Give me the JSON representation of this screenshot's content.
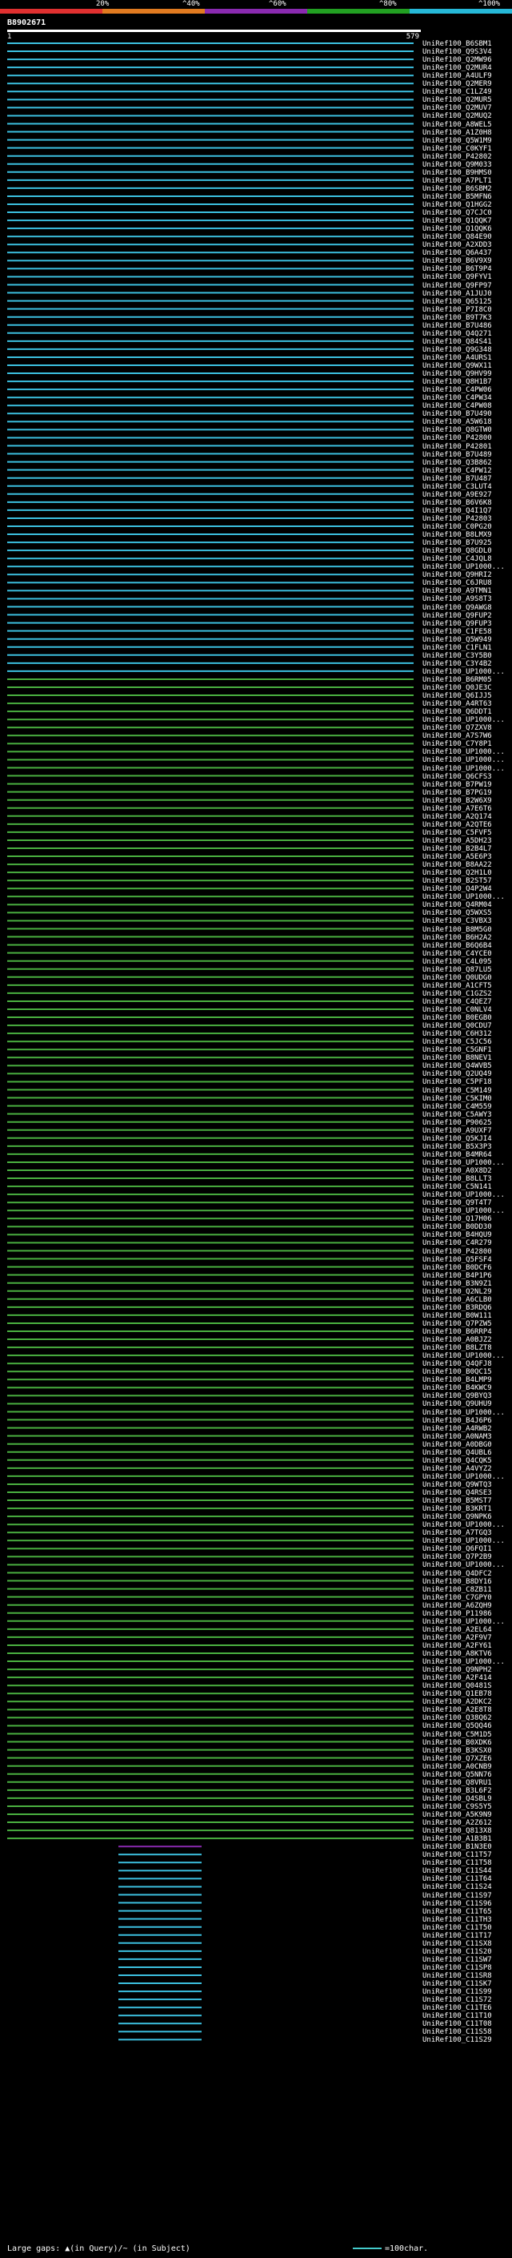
{
  "scale": {
    "labels": [
      "20%",
      "^40%",
      "^60%",
      "^80%",
      "^100%"
    ],
    "colors": [
      "#e03030",
      "#e07a20",
      "#8a2ab0",
      "#22a022",
      "#26b8d8"
    ]
  },
  "query_id": "B8902671",
  "ruler": {
    "start": "1",
    "end": "579"
  },
  "hits": [
    {
      "label": "UniRef100_B6SBM1",
      "color": "#3cc0e0"
    },
    {
      "label": "UniRef100_Q9S3V4",
      "color": "#3cc0e0"
    },
    {
      "label": "UniRef100_Q2MW96",
      "color": "#3cc0e0"
    },
    {
      "label": "UniRef100_Q2MUR4",
      "color": "#3cc0e0"
    },
    {
      "label": "UniRef100_A4ULF9",
      "color": "#3cc0e0"
    },
    {
      "label": "UniRef100_Q2MER9",
      "color": "#3cc0e0"
    },
    {
      "label": "UniRef100_C1LZ49",
      "color": "#3cc0e0"
    },
    {
      "label": "UniRef100_Q2MUR5",
      "color": "#3cc0e0"
    },
    {
      "label": "UniRef100_Q2MUV7",
      "color": "#3cc0e0"
    },
    {
      "label": "UniRef100_Q2MUQ2",
      "color": "#3cc0e0"
    },
    {
      "label": "UniRef100_A8WEL5",
      "color": "#3cc0e0"
    },
    {
      "label": "UniRef100_A1Z0H8",
      "color": "#3cc0e0"
    },
    {
      "label": "UniRef100_Q5W1M9",
      "color": "#3cc0e0"
    },
    {
      "label": "UniRef100_C0KYF1",
      "color": "#3cc0e0"
    },
    {
      "label": "UniRef100_P42802",
      "color": "#3cc0e0"
    },
    {
      "label": "UniRef100_Q9M033",
      "color": "#3cc0e0"
    },
    {
      "label": "UniRef100_B9HMS0",
      "color": "#3cc0e0"
    },
    {
      "label": "UniRef100_A7PLT1",
      "color": "#3cc0e0"
    },
    {
      "label": "UniRef100_B6SBM2",
      "color": "#3cc0e0"
    },
    {
      "label": "UniRef100_B5MFN6",
      "color": "#3cc0e0"
    },
    {
      "label": "UniRef100_Q1HGG2",
      "color": "#3cc0e0"
    },
    {
      "label": "UniRef100_Q7CJC0",
      "color": "#3cc0e0"
    },
    {
      "label": "UniRef100_Q1QQK7",
      "color": "#3cc0e0"
    },
    {
      "label": "UniRef100_Q1QQK6",
      "color": "#3cc0e0"
    },
    {
      "label": "UniRef100_Q84E90",
      "color": "#3cc0e0"
    },
    {
      "label": "UniRef100_A2XDD3",
      "color": "#3cc0e0"
    },
    {
      "label": "UniRef100_Q6A437",
      "color": "#3cc0e0"
    },
    {
      "label": "UniRef100_B6V9X9",
      "color": "#3cc0e0"
    },
    {
      "label": "UniRef100_B6T9P4",
      "color": "#3cc0e0"
    },
    {
      "label": "UniRef100_Q9FYV1",
      "color": "#3cc0e0"
    },
    {
      "label": "UniRef100_Q9FP97",
      "color": "#3cc0e0"
    },
    {
      "label": "UniRef100_A1JUJ0",
      "color": "#3cc0e0"
    },
    {
      "label": "UniRef100_Q65125",
      "color": "#3cc0e0"
    },
    {
      "label": "UniRef100_P7I8C0",
      "color": "#3cc0e0"
    },
    {
      "label": "UniRef100_B9T7K3",
      "color": "#3cc0e0"
    },
    {
      "label": "UniRef100_B7U486",
      "color": "#3cc0e0"
    },
    {
      "label": "UniRef100_Q4Q271",
      "color": "#3cc0e0"
    },
    {
      "label": "UniRef100_Q84S41",
      "color": "#3cc0e0"
    },
    {
      "label": "UniRef100_Q9G348",
      "color": "#3cc0e0"
    },
    {
      "label": "UniRef100_A4URS1",
      "color": "#3cc0e0"
    },
    {
      "label": "UniRef100_Q9WX11",
      "color": "#3cc0e0"
    },
    {
      "label": "UniRef100_Q9HV99",
      "color": "#3cc0e0"
    },
    {
      "label": "UniRef100_Q8H1B7",
      "color": "#3cc0e0"
    },
    {
      "label": "UniRef100_C4PW06",
      "color": "#3cc0e0"
    },
    {
      "label": "UniRef100_C4PW34",
      "color": "#3cc0e0"
    },
    {
      "label": "UniRef100_C4PW08",
      "color": "#3cc0e0"
    },
    {
      "label": "UniRef100_B7U490",
      "color": "#3cc0e0"
    },
    {
      "label": "UniRef100_A5W618",
      "color": "#3cc0e0"
    },
    {
      "label": "UniRef100_Q8GTW0",
      "color": "#3cc0e0"
    },
    {
      "label": "UniRef100_P42800",
      "color": "#3cc0e0"
    },
    {
      "label": "UniRef100_P42801",
      "color": "#3cc0e0"
    },
    {
      "label": "UniRef100_B7U489",
      "color": "#3cc0e0"
    },
    {
      "label": "UniRef100_Q3B862",
      "color": "#3cc0e0"
    },
    {
      "label": "UniRef100_C4PW12",
      "color": "#3cc0e0"
    },
    {
      "label": "UniRef100_B7U487",
      "color": "#3cc0e0"
    },
    {
      "label": "UniRef100_C3LUT4",
      "color": "#3cc0e0"
    },
    {
      "label": "UniRef100_A9E927",
      "color": "#3cc0e0"
    },
    {
      "label": "UniRef100_B6V6K8",
      "color": "#3cc0e0"
    },
    {
      "label": "UniRef100_Q4I1Q7",
      "color": "#3cc0e0"
    },
    {
      "label": "UniRef100_P42803",
      "color": "#3cc0e0"
    },
    {
      "label": "UniRef100_C0PG20",
      "color": "#3cc0e0"
    },
    {
      "label": "UniRef100_B8LMX9",
      "color": "#3cc0e0"
    },
    {
      "label": "UniRef100_B7U925",
      "color": "#3cc0e0"
    },
    {
      "label": "UniRef100_Q8GDL0",
      "color": "#3cc0e0"
    },
    {
      "label": "UniRef100_C4JQL8",
      "color": "#3cc0e0"
    },
    {
      "label": "UniRef100_UP1000...",
      "color": "#3cc0e0"
    },
    {
      "label": "UniRef100_Q9HRI2",
      "color": "#3cc0e0"
    },
    {
      "label": "UniRef100_C6JRU8",
      "color": "#3cc0e0"
    },
    {
      "label": "UniRef100_A9TMN1",
      "color": "#3cc0e0"
    },
    {
      "label": "UniRef100_A9S8T3",
      "color": "#3cc0e0"
    },
    {
      "label": "UniRef100_Q9AWG8",
      "color": "#3cc0e0"
    },
    {
      "label": "UniRef100_Q9FUP2",
      "color": "#3cc0e0"
    },
    {
      "label": "UniRef100_Q9FUP3",
      "color": "#3cc0e0"
    },
    {
      "label": "UniRef100_C1FE58",
      "color": "#3cc0e0"
    },
    {
      "label": "UniRef100_Q5W949",
      "color": "#3cc0e0"
    },
    {
      "label": "UniRef100_C1FLN1",
      "color": "#3cc0e0"
    },
    {
      "label": "UniRef100_C3Y5B0",
      "color": "#3cc0e0"
    },
    {
      "label": "UniRef100_C3Y4B2",
      "color": "#3cc0e0"
    },
    {
      "label": "UniRef100_UP1000...",
      "color": "#3cc0e0"
    },
    {
      "label": "UniRef100_B6RM05",
      "color": "#4ab040"
    },
    {
      "label": "UniRef100_Q0JE3C",
      "color": "#4ab040"
    },
    {
      "label": "UniRef100_Q6IJJ5",
      "color": "#4ab040"
    },
    {
      "label": "UniRef100_A4RT63",
      "color": "#4ab040"
    },
    {
      "label": "UniRef100_Q6DDT1",
      "color": "#4ab040"
    },
    {
      "label": "UniRef100_UP1000...",
      "color": "#4ab040"
    },
    {
      "label": "UniRef100_Q7ZXV8",
      "color": "#4ab040"
    },
    {
      "label": "UniRef100_A7S7W6",
      "color": "#4ab040"
    },
    {
      "label": "UniRef100_C7Y8P1",
      "color": "#4ab040"
    },
    {
      "label": "UniRef100_UP1000...",
      "color": "#4ab040"
    },
    {
      "label": "UniRef100_UP1000...",
      "color": "#4ab040"
    },
    {
      "label": "UniRef100_UP1000...",
      "color": "#4ab040"
    },
    {
      "label": "UniRef100_Q6CFS3",
      "color": "#4ab040"
    },
    {
      "label": "UniRef100_B7PW19",
      "color": "#4ab040"
    },
    {
      "label": "UniRef100_B7PG19",
      "color": "#4ab040"
    },
    {
      "label": "UniRef100_B2W6X9",
      "color": "#4ab040"
    },
    {
      "label": "UniRef100_A7E6T6",
      "color": "#4ab040"
    },
    {
      "label": "UniRef100_A2Q174",
      "color": "#4ab040"
    },
    {
      "label": "UniRef100_A2QTE6",
      "color": "#4ab040"
    },
    {
      "label": "UniRef100_C5FVF5",
      "color": "#4ab040"
    },
    {
      "label": "UniRef100_A5DH23",
      "color": "#4ab040"
    },
    {
      "label": "UniRef100_B2B4L7",
      "color": "#4ab040"
    },
    {
      "label": "UniRef100_A5E6P3",
      "color": "#4ab040"
    },
    {
      "label": "UniRef100_B8AA22",
      "color": "#4ab040"
    },
    {
      "label": "UniRef100_Q2H1L0",
      "color": "#4ab040"
    },
    {
      "label": "UniRef100_B2ST57",
      "color": "#4ab040"
    },
    {
      "label": "UniRef100_Q4P2W4",
      "color": "#4ab040"
    },
    {
      "label": "UniRef100_UP1000...",
      "color": "#4ab040"
    },
    {
      "label": "UniRef100_Q4RM04",
      "color": "#4ab040"
    },
    {
      "label": "UniRef100_Q5WXS5",
      "color": "#4ab040"
    },
    {
      "label": "UniRef100_C3VBX3",
      "color": "#4ab040"
    },
    {
      "label": "UniRef100_B8M5G0",
      "color": "#4ab040"
    },
    {
      "label": "UniRef100_B6H2A2",
      "color": "#4ab040"
    },
    {
      "label": "UniRef100_B6Q6B4",
      "color": "#4ab040"
    },
    {
      "label": "UniRef100_C4YCE0",
      "color": "#4ab040"
    },
    {
      "label": "UniRef100_C4L095",
      "color": "#4ab040"
    },
    {
      "label": "UniRef100_Q87LU5",
      "color": "#4ab040"
    },
    {
      "label": "UniRef100_Q0UDG0",
      "color": "#4ab040"
    },
    {
      "label": "UniRef100_A1CFT5",
      "color": "#4ab040"
    },
    {
      "label": "UniRef100_C1GZS2",
      "color": "#4ab040"
    },
    {
      "label": "UniRef100_C4QEZ7",
      "color": "#4ab040"
    },
    {
      "label": "UniRef100_C0NLV4",
      "color": "#4ab040"
    },
    {
      "label": "UniRef100_B0EGB0",
      "color": "#4ab040"
    },
    {
      "label": "UniRef100_Q0CDU7",
      "color": "#4ab040"
    },
    {
      "label": "UniRef100_C6H312",
      "color": "#4ab040"
    },
    {
      "label": "UniRef100_C5JC56",
      "color": "#4ab040"
    },
    {
      "label": "UniRef100_C5GNF1",
      "color": "#4ab040"
    },
    {
      "label": "UniRef100_B8NEV1",
      "color": "#4ab040"
    },
    {
      "label": "UniRef100_Q4WVB5",
      "color": "#4ab040"
    },
    {
      "label": "UniRef100_Q2UQ49",
      "color": "#4ab040"
    },
    {
      "label": "UniRef100_C5PF18",
      "color": "#4ab040"
    },
    {
      "label": "UniRef100_C5M149",
      "color": "#4ab040"
    },
    {
      "label": "UniRef100_C5KIM0",
      "color": "#4ab040"
    },
    {
      "label": "UniRef100_C4M559",
      "color": "#4ab040"
    },
    {
      "label": "UniRef100_C5AWY3",
      "color": "#4ab040"
    },
    {
      "label": "UniRef100_P90625",
      "color": "#4ab040"
    },
    {
      "label": "UniRef100_A9UXF7",
      "color": "#4ab040"
    },
    {
      "label": "UniRef100_Q5KJI4",
      "color": "#4ab040"
    },
    {
      "label": "UniRef100_B5X3P3",
      "color": "#4ab040"
    },
    {
      "label": "UniRef100_B4MR64",
      "color": "#4ab040"
    },
    {
      "label": "UniRef100_UP1000...",
      "color": "#4ab040"
    },
    {
      "label": "UniRef100_A0X8D2",
      "color": "#4ab040"
    },
    {
      "label": "UniRef100_B8LLT3",
      "color": "#4ab040"
    },
    {
      "label": "UniRef100_C5N141",
      "color": "#4ab040"
    },
    {
      "label": "UniRef100_UP1000...",
      "color": "#4ab040"
    },
    {
      "label": "UniRef100_Q9T4T7",
      "color": "#4ab040"
    },
    {
      "label": "UniRef100_UP1000...",
      "color": "#4ab040"
    },
    {
      "label": "UniRef100_Q17H06",
      "color": "#4ab040"
    },
    {
      "label": "UniRef100_B0DD30",
      "color": "#4ab040"
    },
    {
      "label": "UniRef100_B4HQU9",
      "color": "#4ab040"
    },
    {
      "label": "UniRef100_C4R279",
      "color": "#4ab040"
    },
    {
      "label": "UniRef100_P42800",
      "color": "#4ab040"
    },
    {
      "label": "UniRef100_Q5FSF4",
      "color": "#4ab040"
    },
    {
      "label": "UniRef100_B0DCF6",
      "color": "#4ab040"
    },
    {
      "label": "UniRef100_B4P1P6",
      "color": "#4ab040"
    },
    {
      "label": "UniRef100_B3N9Z1",
      "color": "#4ab040"
    },
    {
      "label": "UniRef100_Q2NL29",
      "color": "#4ab040"
    },
    {
      "label": "UniRef100_A6CLB0",
      "color": "#4ab040"
    },
    {
      "label": "UniRef100_B3RDQ6",
      "color": "#4ab040"
    },
    {
      "label": "UniRef100_B0W111",
      "color": "#4ab040"
    },
    {
      "label": "UniRef100_Q7PZW5",
      "color": "#4ab040"
    },
    {
      "label": "UniRef100_B6RRP4",
      "color": "#4ab040"
    },
    {
      "label": "UniRef100_A0BJZ2",
      "color": "#4ab040"
    },
    {
      "label": "UniRef100_B8LZT8",
      "color": "#4ab040"
    },
    {
      "label": "UniRef100_UP1000...",
      "color": "#4ab040"
    },
    {
      "label": "UniRef100_Q4QFJ8",
      "color": "#4ab040"
    },
    {
      "label": "UniRef100_B0QC15",
      "color": "#4ab040"
    },
    {
      "label": "UniRef100_B4LMP9",
      "color": "#4ab040"
    },
    {
      "label": "UniRef100_B4KWC9",
      "color": "#4ab040"
    },
    {
      "label": "UniRef100_Q9BYQ3",
      "color": "#4ab040"
    },
    {
      "label": "UniRef100_Q9UHU9",
      "color": "#4ab040"
    },
    {
      "label": "UniRef100_UP1000...",
      "color": "#4ab040"
    },
    {
      "label": "UniRef100_B4J6P6",
      "color": "#4ab040"
    },
    {
      "label": "UniRef100_A4RWB2",
      "color": "#4ab040"
    },
    {
      "label": "UniRef100_A0NAM3",
      "color": "#4ab040"
    },
    {
      "label": "UniRef100_A0DBG0",
      "color": "#4ab040"
    },
    {
      "label": "UniRef100_Q4UBL6",
      "color": "#4ab040"
    },
    {
      "label": "UniRef100_Q4CQK5",
      "color": "#4ab040"
    },
    {
      "label": "UniRef100_A4VYZ2",
      "color": "#4ab040"
    },
    {
      "label": "UniRef100_UP1000...",
      "color": "#4ab040"
    },
    {
      "label": "UniRef100_Q9WTQ3",
      "color": "#4ab040"
    },
    {
      "label": "UniRef100_Q4RSE3",
      "color": "#4ab040"
    },
    {
      "label": "UniRef100_B5MST7",
      "color": "#4ab040"
    },
    {
      "label": "UniRef100_B3KRT1",
      "color": "#4ab040"
    },
    {
      "label": "UniRef100_Q9NPK6",
      "color": "#4ab040"
    },
    {
      "label": "UniRef100_UP1000...",
      "color": "#4ab040"
    },
    {
      "label": "UniRef100_A7TGQ3",
      "color": "#4ab040"
    },
    {
      "label": "UniRef100_UP1000...",
      "color": "#4ab040"
    },
    {
      "label": "UniRef100_Q6FQI1",
      "color": "#4ab040"
    },
    {
      "label": "UniRef100_Q7P2B9",
      "color": "#4ab040"
    },
    {
      "label": "UniRef100_UP1000...",
      "color": "#4ab040"
    },
    {
      "label": "UniRef100_Q4DFC2",
      "color": "#4ab040"
    },
    {
      "label": "UniRef100_B8DY16",
      "color": "#4ab040"
    },
    {
      "label": "UniRef100_C8ZB11",
      "color": "#4ab040"
    },
    {
      "label": "UniRef100_C7GPY0",
      "color": "#4ab040"
    },
    {
      "label": "UniRef100_A6ZQH9",
      "color": "#4ab040"
    },
    {
      "label": "UniRef100_P11986",
      "color": "#4ab040"
    },
    {
      "label": "UniRef100_UP1000...",
      "color": "#4ab040"
    },
    {
      "label": "UniRef100_A2EL64",
      "color": "#4ab040"
    },
    {
      "label": "UniRef100_A2F9V7",
      "color": "#4ab040"
    },
    {
      "label": "UniRef100_A2FY61",
      "color": "#4ab040"
    },
    {
      "label": "UniRef100_A8KTV6",
      "color": "#4ab040"
    },
    {
      "label": "UniRef100_UP1000...",
      "color": "#4ab040"
    },
    {
      "label": "UniRef100_Q9NPH2",
      "color": "#4ab040"
    },
    {
      "label": "UniRef100_A2F414",
      "color": "#4ab040"
    },
    {
      "label": "UniRef100_Q0481S",
      "color": "#4ab040"
    },
    {
      "label": "UniRef100_Q1EB78",
      "color": "#4ab040"
    },
    {
      "label": "UniRef100_A2DKC2",
      "color": "#4ab040"
    },
    {
      "label": "UniRef100_A2E8T8",
      "color": "#4ab040"
    },
    {
      "label": "UniRef100_Q38Q62",
      "color": "#4ab040"
    },
    {
      "label": "UniRef100_Q5QQ46",
      "color": "#4ab040"
    },
    {
      "label": "UniRef100_C5M1D5",
      "color": "#4ab040"
    },
    {
      "label": "UniRef100_B0XDK6",
      "color": "#4ab040"
    },
    {
      "label": "UniRef100_B3KSX0",
      "color": "#4ab040"
    },
    {
      "label": "UniRef100_Q7XZE6",
      "color": "#4ab040"
    },
    {
      "label": "UniRef100_A0CNB9",
      "color": "#4ab040"
    },
    {
      "label": "UniRef100_Q5NN76",
      "color": "#4ab040"
    },
    {
      "label": "UniRef100_Q8VRU1",
      "color": "#4ab040"
    },
    {
      "label": "UniRef100_B3L6F2",
      "color": "#4ab040"
    },
    {
      "label": "UniRef100_Q4SBL9",
      "color": "#4ab040"
    },
    {
      "label": "UniRef100_C9S5Y5",
      "color": "#4ab040"
    },
    {
      "label": "UniRef100_A5K9N9",
      "color": "#4ab040"
    },
    {
      "label": "UniRef100_A2Z612",
      "color": "#4ab040"
    },
    {
      "label": "UniRef100_Q813X8",
      "color": "#4ab040"
    },
    {
      "label": "UniRef100_A1B3B1",
      "color": "#4ab040"
    },
    {
      "label": "UniRef100_B1N3E0",
      "color": "#8a2ab0"
    },
    {
      "label": "UniRef100_C11T57",
      "color": "#3cc0e0"
    },
    {
      "label": "UniRef100_C11T58",
      "color": "#3cc0e0"
    },
    {
      "label": "UniRef100_C11S44",
      "color": "#3cc0e0"
    },
    {
      "label": "UniRef100_C11T64",
      "color": "#3cc0e0"
    },
    {
      "label": "UniRef100_C11S24",
      "color": "#3cc0e0"
    },
    {
      "label": "UniRef100_C11S97",
      "color": "#3cc0e0"
    },
    {
      "label": "UniRef100_C11S96",
      "color": "#3cc0e0"
    },
    {
      "label": "UniRef100_C11T65",
      "color": "#3cc0e0"
    },
    {
      "label": "UniRef100_C11TH3",
      "color": "#3cc0e0"
    },
    {
      "label": "UniRef100_C11T50",
      "color": "#3cc0e0"
    },
    {
      "label": "UniRef100_C11T17",
      "color": "#3cc0e0"
    },
    {
      "label": "UniRef100_C11SX8",
      "color": "#3cc0e0"
    },
    {
      "label": "UniRef100_C11S20",
      "color": "#3cc0e0"
    },
    {
      "label": "UniRef100_C11SW7",
      "color": "#3cc0e0"
    },
    {
      "label": "UniRef100_C11SP8",
      "color": "#3cc0e0"
    },
    {
      "label": "UniRef100_C11SR8",
      "color": "#3cc0e0"
    },
    {
      "label": "UniRef100_C11SK7",
      "color": "#3cc0e0"
    },
    {
      "label": "UniRef100_C11S99",
      "color": "#3cc0e0"
    },
    {
      "label": "UniRef100_C11S72",
      "color": "#3cc0e0"
    },
    {
      "label": "UniRef100_C11TE6",
      "color": "#3cc0e0"
    },
    {
      "label": "UniRef100_C11T10",
      "color": "#3cc0e0"
    },
    {
      "label": "UniRef100_C11T08",
      "color": "#3cc0e0"
    },
    {
      "label": "UniRef100_C11S58",
      "color": "#3cc0e0"
    },
    {
      "label": "UniRef100_C11S29",
      "color": "#3cc0e0"
    }
  ],
  "footer": {
    "legend": "Large gaps: ▲(in Query)/~ (in Subject)",
    "scale_key": "=100char."
  }
}
